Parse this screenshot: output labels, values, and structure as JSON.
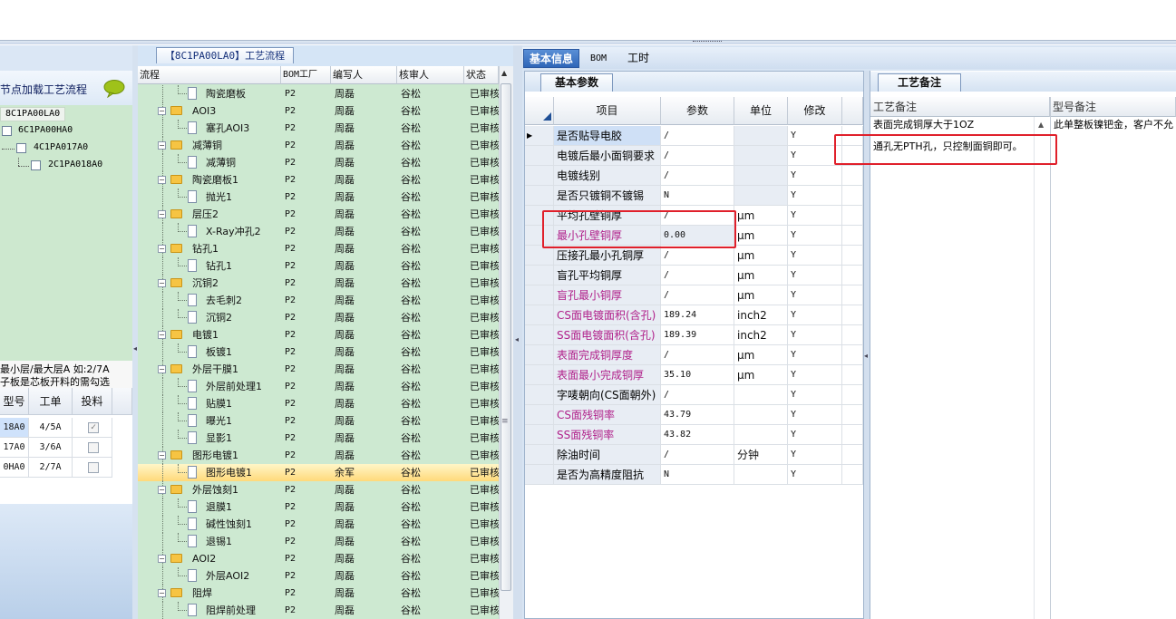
{
  "left": {
    "header": "节点加载工艺流程",
    "tree": [
      {
        "label": "8C1PA00LA0"
      },
      {
        "label": "6C1PA00HA0"
      },
      {
        "label": "4C1PA017A0"
      },
      {
        "label": "2C1PA018A0"
      }
    ],
    "notes": [
      "最小层/最大层A 如:2/7A",
      "子板是芯板开料的需勾选"
    ],
    "grid": {
      "headers": [
        "型号",
        "工单",
        "投料"
      ],
      "rows": [
        {
          "model": "18A0",
          "order": "4/5A",
          "checked": true
        },
        {
          "model": "17A0",
          "order": "3/6A",
          "checked": false
        },
        {
          "model": "0HA0",
          "order": "2/7A",
          "checked": false
        }
      ]
    }
  },
  "flow": {
    "tab": "【8C1PA00LA0】工艺流程",
    "headers": [
      "流程",
      "BOM工厂",
      "编写人",
      "核审人",
      "状态"
    ],
    "rows": [
      {
        "name": "陶瓷磨板",
        "type": "doc",
        "factory": "P2",
        "writer": "周磊",
        "reviewer": "谷松",
        "status": "已审核"
      },
      {
        "name": "AOI3",
        "type": "folder",
        "factory": "P2",
        "writer": "周磊",
        "reviewer": "谷松",
        "status": "已审核"
      },
      {
        "name": "塞孔AOI3",
        "type": "doc",
        "factory": "P2",
        "writer": "周磊",
        "reviewer": "谷松",
        "status": "已审核"
      },
      {
        "name": "减薄铜",
        "type": "folder",
        "factory": "P2",
        "writer": "周磊",
        "reviewer": "谷松",
        "status": "已审核"
      },
      {
        "name": "减薄铜",
        "type": "doc",
        "factory": "P2",
        "writer": "周磊",
        "reviewer": "谷松",
        "status": "已审核"
      },
      {
        "name": "陶瓷磨板1",
        "type": "folder",
        "factory": "P2",
        "writer": "周磊",
        "reviewer": "谷松",
        "status": "已审核"
      },
      {
        "name": "抛光1",
        "type": "doc",
        "factory": "P2",
        "writer": "周磊",
        "reviewer": "谷松",
        "status": "已审核"
      },
      {
        "name": "层压2",
        "type": "folder",
        "factory": "P2",
        "writer": "周磊",
        "reviewer": "谷松",
        "status": "已审核"
      },
      {
        "name": "X-Ray冲孔2",
        "type": "doc",
        "factory": "P2",
        "writer": "周磊",
        "reviewer": "谷松",
        "status": "已审核"
      },
      {
        "name": "钻孔1",
        "type": "folder",
        "factory": "P2",
        "writer": "周磊",
        "reviewer": "谷松",
        "status": "已审核"
      },
      {
        "name": "钻孔1",
        "type": "doc",
        "factory": "P2",
        "writer": "周磊",
        "reviewer": "谷松",
        "status": "已审核"
      },
      {
        "name": "沉铜2",
        "type": "folder",
        "factory": "P2",
        "writer": "周磊",
        "reviewer": "谷松",
        "status": "已审核"
      },
      {
        "name": "去毛刺2",
        "type": "doc",
        "factory": "P2",
        "writer": "周磊",
        "reviewer": "谷松",
        "status": "已审核"
      },
      {
        "name": "沉铜2",
        "type": "doc",
        "factory": "P2",
        "writer": "周磊",
        "reviewer": "谷松",
        "status": "已审核"
      },
      {
        "name": "电镀1",
        "type": "folder",
        "factory": "P2",
        "writer": "周磊",
        "reviewer": "谷松",
        "status": "已审核"
      },
      {
        "name": "板镀1",
        "type": "doc",
        "factory": "P2",
        "writer": "周磊",
        "reviewer": "谷松",
        "status": "已审核"
      },
      {
        "name": "外层干膜1",
        "type": "folder",
        "factory": "P2",
        "writer": "周磊",
        "reviewer": "谷松",
        "status": "已审核"
      },
      {
        "name": "外层前处理1",
        "type": "doc",
        "factory": "P2",
        "writer": "周磊",
        "reviewer": "谷松",
        "status": "已审核"
      },
      {
        "name": "贴膜1",
        "type": "doc",
        "factory": "P2",
        "writer": "周磊",
        "reviewer": "谷松",
        "status": "已审核"
      },
      {
        "name": "曝光1",
        "type": "doc",
        "factory": "P2",
        "writer": "周磊",
        "reviewer": "谷松",
        "status": "已审核"
      },
      {
        "name": "显影1",
        "type": "doc",
        "factory": "P2",
        "writer": "周磊",
        "reviewer": "谷松",
        "status": "已审核"
      },
      {
        "name": "图形电镀1",
        "type": "folder",
        "factory": "P2",
        "writer": "周磊",
        "reviewer": "谷松",
        "status": "已审核"
      },
      {
        "name": "图形电镀1",
        "type": "doc",
        "factory": "P2",
        "writer": "余军",
        "reviewer": "谷松",
        "status": "已审核",
        "selected": true
      },
      {
        "name": "外层蚀刻1",
        "type": "folder",
        "factory": "P2",
        "writer": "周磊",
        "reviewer": "谷松",
        "status": "已审核"
      },
      {
        "name": "退膜1",
        "type": "doc",
        "factory": "P2",
        "writer": "周磊",
        "reviewer": "谷松",
        "status": "已审核"
      },
      {
        "name": "碱性蚀刻1",
        "type": "doc",
        "factory": "P2",
        "writer": "周磊",
        "reviewer": "谷松",
        "status": "已审核"
      },
      {
        "name": "退锡1",
        "type": "doc",
        "factory": "P2",
        "writer": "周磊",
        "reviewer": "谷松",
        "status": "已审核"
      },
      {
        "name": "AOI2",
        "type": "folder",
        "factory": "P2",
        "writer": "周磊",
        "reviewer": "谷松",
        "status": "已审核"
      },
      {
        "name": "外层AOI2",
        "type": "doc",
        "factory": "P2",
        "writer": "周磊",
        "reviewer": "谷松",
        "status": "已审核"
      },
      {
        "name": "阻焊",
        "type": "folder",
        "factory": "P2",
        "writer": "周磊",
        "reviewer": "谷松",
        "status": "已审核"
      },
      {
        "name": "阻焊前处理",
        "type": "doc",
        "factory": "P2",
        "writer": "周磊",
        "reviewer": "谷松",
        "status": "已审核"
      }
    ]
  },
  "tabs": {
    "basic": "基本信息",
    "bom": "BOM",
    "hours": "工时"
  },
  "params": {
    "tab": "基本参数",
    "headers": [
      "项目",
      "参数",
      "单位",
      "修改"
    ],
    "rows": [
      {
        "item": "是否贴导电胶",
        "value": "/",
        "unit": "",
        "mod": "Y",
        "color": "#000000",
        "current": true
      },
      {
        "item": "电镀后最小面铜要求",
        "value": "/",
        "unit": "",
        "mod": "Y",
        "color": "#000000"
      },
      {
        "item": "电镀线别",
        "value": "/",
        "unit": "",
        "mod": "Y",
        "color": "#000000"
      },
      {
        "item": "是否只镀铜不镀锡",
        "value": "N",
        "unit": "",
        "mod": "Y",
        "color": "#000000"
      },
      {
        "item": "平均孔壁铜厚",
        "value": "/",
        "unit": "μm",
        "mod": "Y",
        "color": "#000000"
      },
      {
        "item": "最小孔壁铜厚",
        "value": "0.00",
        "unit": "μm",
        "mod": "Y",
        "color": "#b0208a"
      },
      {
        "item": "压接孔最小孔铜厚",
        "value": "/",
        "unit": "μm",
        "mod": "Y",
        "color": "#000000"
      },
      {
        "item": "盲孔平均铜厚",
        "value": "/",
        "unit": "μm",
        "mod": "Y",
        "color": "#000000"
      },
      {
        "item": "盲孔最小铜厚",
        "value": "/",
        "unit": "μm",
        "mod": "Y",
        "color": "#b0208a"
      },
      {
        "item": "CS面电镀面积(含孔)",
        "value": "189.24",
        "unit": "inch2",
        "mod": "Y",
        "color": "#b0208a"
      },
      {
        "item": "SS面电镀面积(含孔)",
        "value": "189.39",
        "unit": "inch2",
        "mod": "Y",
        "color": "#b0208a"
      },
      {
        "item": "表面完成铜厚度",
        "value": "/",
        "unit": "μm",
        "mod": "Y",
        "color": "#b0208a"
      },
      {
        "item": "表面最小完成铜厚",
        "value": "35.10",
        "unit": "μm",
        "mod": "Y",
        "color": "#b0208a"
      },
      {
        "item": "字唛朝向(CS面朝外)",
        "value": "/",
        "unit": "",
        "mod": "Y",
        "color": "#000000"
      },
      {
        "item": "CS面残铜率",
        "value": "43.79",
        "unit": "",
        "mod": "Y",
        "color": "#b0208a"
      },
      {
        "item": "SS面残铜率",
        "value": "43.82",
        "unit": "",
        "mod": "Y",
        "color": "#b0208a"
      },
      {
        "item": "除油时间",
        "value": "/",
        "unit": "分钟",
        "mod": "Y",
        "color": "#000000"
      },
      {
        "item": "是否为高精度阻抗",
        "value": "N",
        "unit": "",
        "mod": "Y",
        "color": "#000000"
      }
    ]
  },
  "remarks": {
    "tab": "工艺备注",
    "headers": [
      "工艺备注",
      "型号备注"
    ],
    "process_lines": [
      "表面完成铜厚大于1OZ",
      "通孔无PTH孔，只控制面铜即可。"
    ],
    "model_line": "此单整板镍钯金，客户不允"
  }
}
